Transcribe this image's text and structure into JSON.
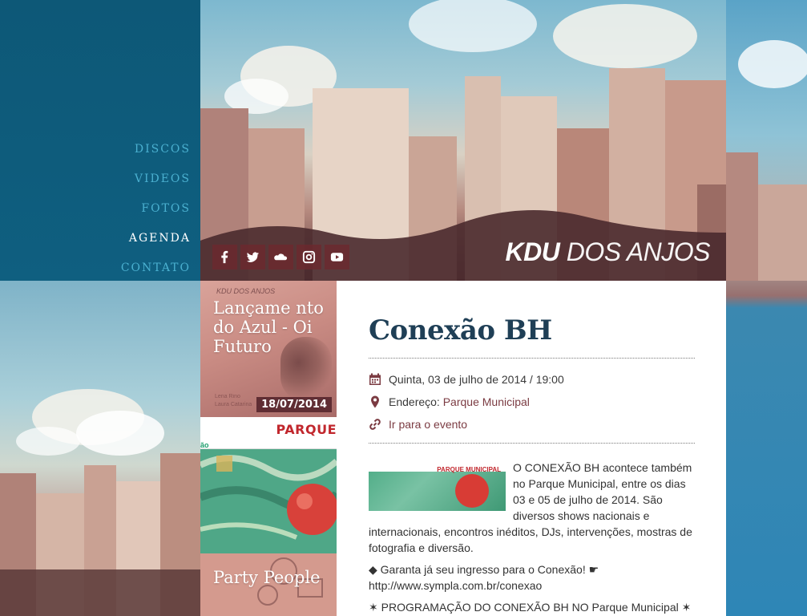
{
  "nav": {
    "items": [
      {
        "label": "DISCOS",
        "active": false
      },
      {
        "label": "VIDEOS",
        "active": false
      },
      {
        "label": "FOTOS",
        "active": false
      },
      {
        "label": "AGENDA",
        "active": true
      },
      {
        "label": "CONTATO",
        "active": false
      }
    ]
  },
  "social": {
    "icons": [
      "facebook-icon",
      "twitter-icon",
      "soundcloud-icon",
      "instagram-icon",
      "youtube-icon"
    ],
    "color": "#6e282d"
  },
  "brand": {
    "bold": "KDU",
    "rest": "DOS ANJOS"
  },
  "thumbs": {
    "first": {
      "title": "Lançame nto do Azul - Oi Futuro",
      "date": "18/07/2014",
      "small_brand": "KDU DOS ANJOS",
      "names": [
        "Lena Rino",
        "Laura Catarina"
      ]
    },
    "second": {
      "banner": "PARQUE",
      "corner": "ão"
    },
    "third": {
      "title": "Party People"
    }
  },
  "event": {
    "title": "Conexão BH",
    "date": "Quinta, 03 de julho de 2014 / 19:00",
    "address_label": "Endereço:",
    "address_value": "Parque Municipal",
    "link_text": "Ir para o evento",
    "flyer_banner": "PARQUE MUNICIPAL",
    "paragraph1": "O CONEXÃO BH acontece também no Parque Municipal, entre os dias 03 e 05 de julho de 2014. São diversos shows nacionais e internacionais, encontros inéditos, DJs, intervenções, mostras de fotografia e diversão.",
    "paragraph2_line1": "◆ Garanta já seu ingresso para o Conexão! ☛",
    "paragraph2_line2": "http://www.sympla.com.br/conexao",
    "paragraph3": "✶ PROGRAMAÇÃO DO CONEXÃO BH NO Parque Municipal ✶"
  },
  "colors": {
    "nav_bg": "#0f5f80",
    "nav_text": "#4ab0d0",
    "nav_active": "#ffffff",
    "title": "#1f3f56",
    "accent": "#7b3b42",
    "date_badge": "#5f2d33"
  }
}
